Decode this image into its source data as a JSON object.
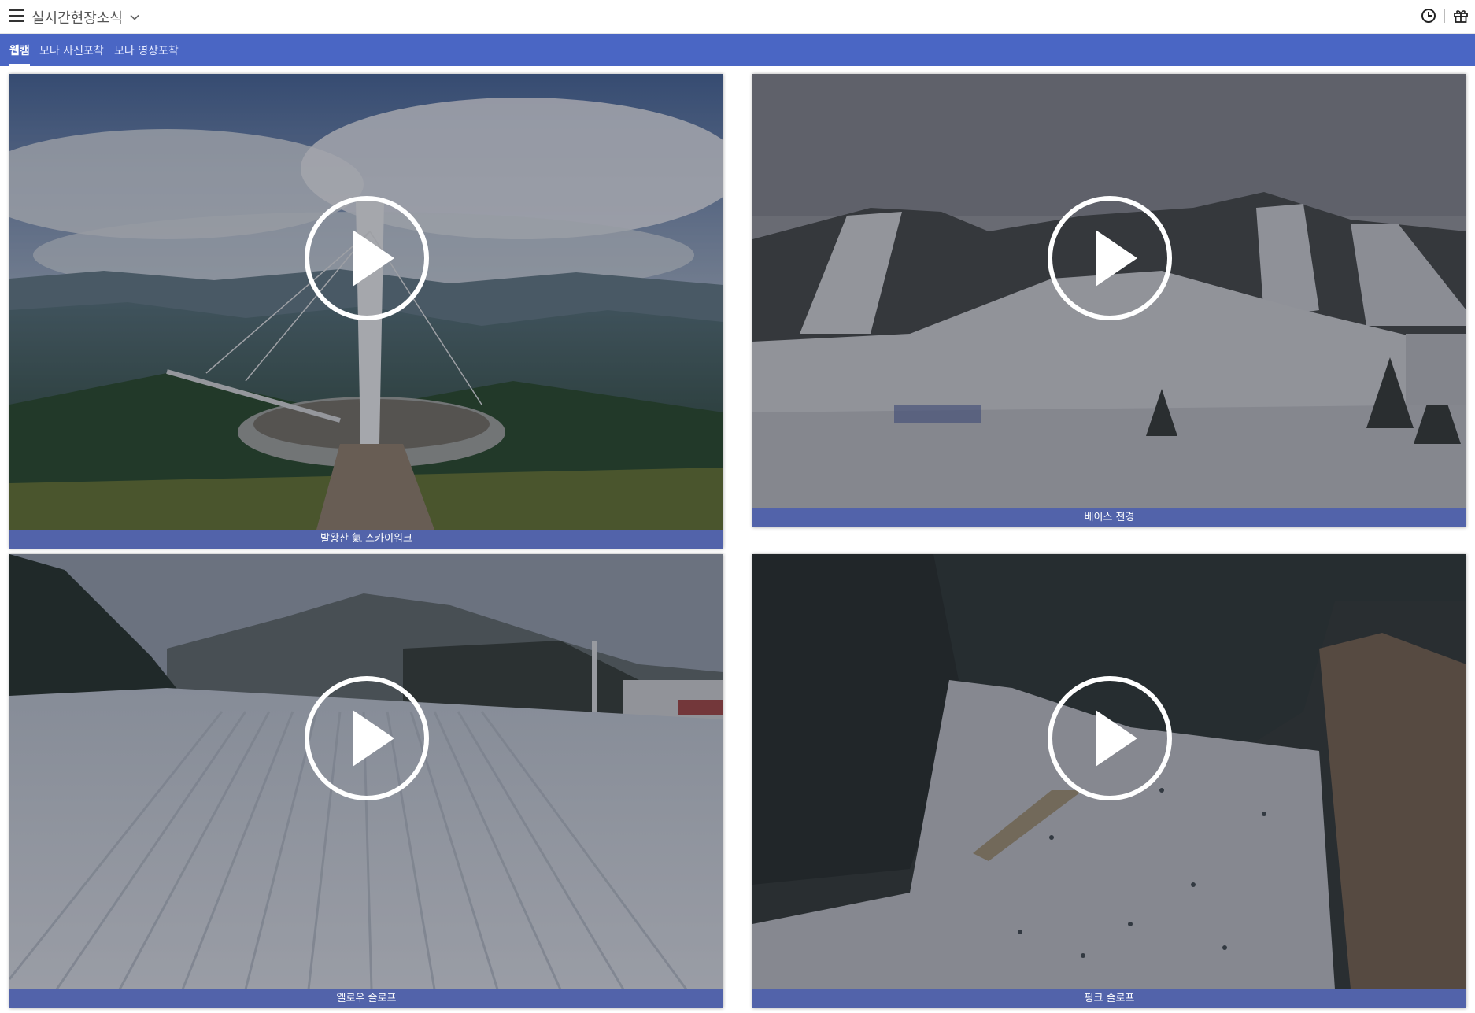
{
  "header": {
    "title": "실시간현장소식",
    "menu_icon": "hamburger-menu-icon",
    "dropdown_icon": "chevron-down-icon",
    "history_icon": "clock-icon",
    "gift_icon": "gift-icon"
  },
  "tabs": [
    {
      "label": "웹캠",
      "active": true
    },
    {
      "label": "모나 사진포착",
      "active": false
    },
    {
      "label": "모나 영상포착",
      "active": false
    }
  ],
  "colors": {
    "tab_bar": "#4a66c4",
    "caption_bar": "#34489b"
  },
  "webcams": [
    {
      "caption": "발왕산 氣 스카이워크",
      "scene": "mountain-skywalk"
    },
    {
      "caption": "베이스 전경",
      "scene": "ski-base"
    },
    {
      "caption": "옐로우 슬로프",
      "scene": "yellow-slope"
    },
    {
      "caption": "핑크 슬로프",
      "scene": "pink-slope"
    }
  ]
}
